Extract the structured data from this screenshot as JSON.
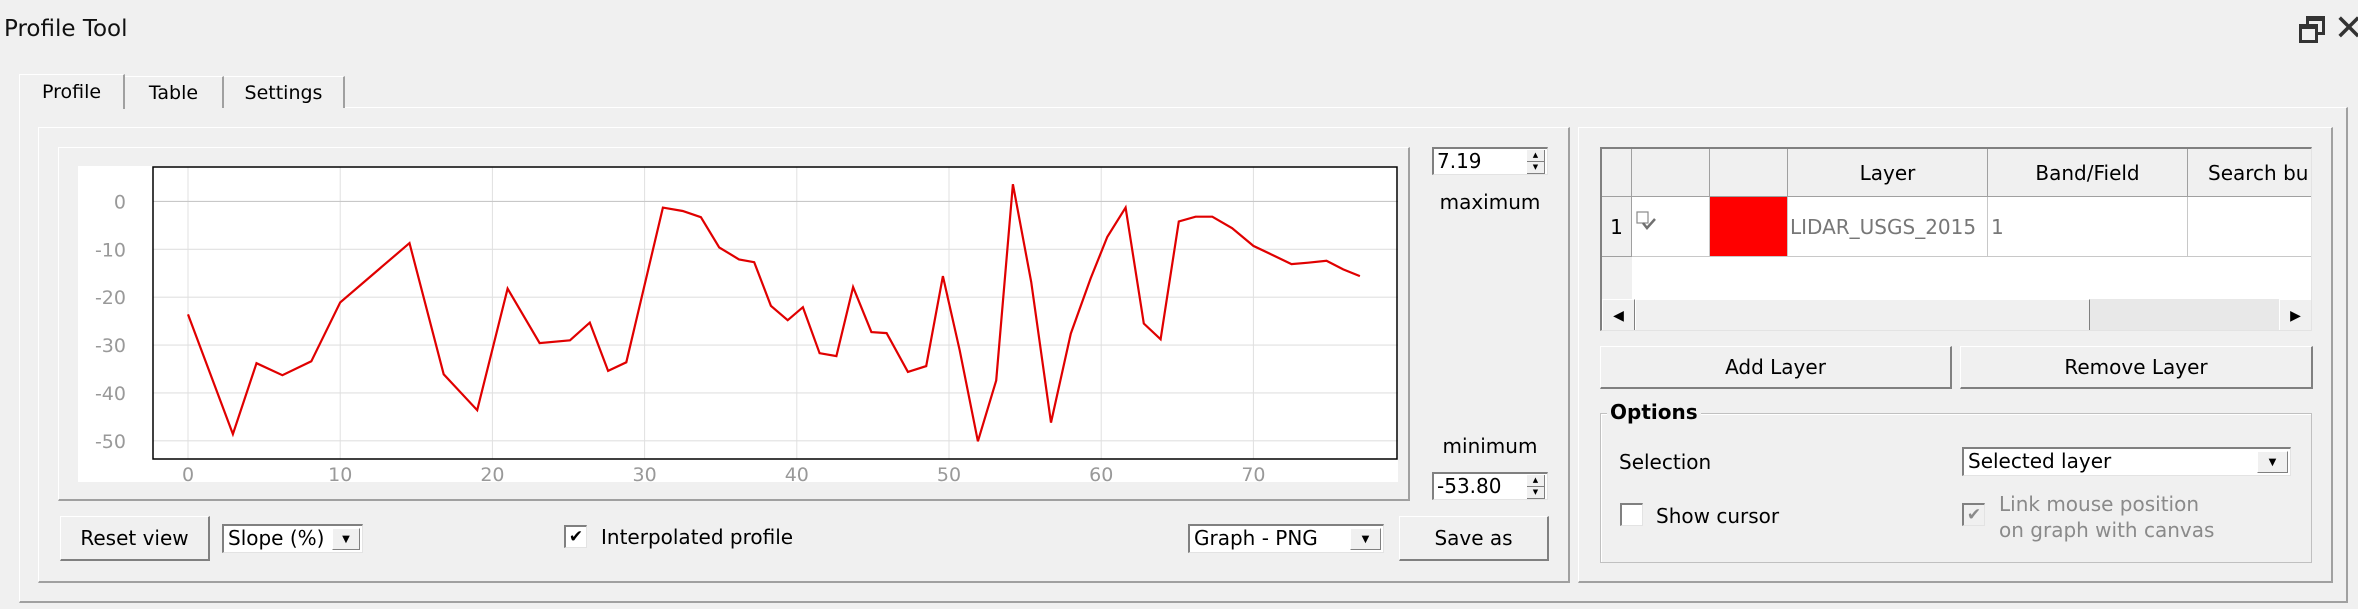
{
  "window": {
    "title": "Profile Tool",
    "restore_icon": "restore-window-icon",
    "close_icon": "close-icon"
  },
  "tabs": [
    {
      "label": "Profile",
      "selected": true
    },
    {
      "label": "Table",
      "selected": false
    },
    {
      "label": "Settings",
      "selected": false
    }
  ],
  "profile": {
    "max_value": "7.19",
    "max_label": "maximum",
    "min_value": "-53.80",
    "min_label": "minimum",
    "reset_view_label": "Reset view",
    "mode_select_value": "Slope (%)",
    "interpolated_label": "Interpolated profile",
    "interpolated_checked": true,
    "export_format_value": "Graph - PNG",
    "save_as_label": "Save as"
  },
  "layers_panel": {
    "columns": [
      "",
      "",
      "Layer",
      "Band/Field",
      "Search bu"
    ],
    "rows": [
      {
        "index": "1",
        "visible_icon": "checked-visibility-icon",
        "color": "#ff0000",
        "layer": "LIDAR_USGS_2015",
        "band": "1",
        "search": ""
      }
    ],
    "add_layer_label": "Add Layer",
    "remove_layer_label": "Remove Layer",
    "scroll_left_icon": "arrow-left-icon",
    "scroll_right_icon": "arrow-right-icon"
  },
  "options": {
    "title": "Options",
    "selection_label": "Selection",
    "selection_value": "Selected layer",
    "show_cursor_label": "Show cursor",
    "show_cursor_checked": false,
    "link_mouse_line1": "Link mouse position",
    "link_mouse_line2": "on graph with canvas",
    "link_mouse_checked": true,
    "link_mouse_enabled": false
  },
  "chart_data": {
    "type": "line",
    "title": "",
    "xlabel": "",
    "ylabel": "",
    "xlim": [
      -2.3,
      79.5
    ],
    "ylim": [
      -53.8,
      7.19
    ],
    "grid": true,
    "legend": "none",
    "x_ticks": [
      0,
      10,
      20,
      30,
      40,
      50,
      60,
      70
    ],
    "y_ticks": [
      0,
      -10,
      -20,
      -30,
      -40,
      -50
    ],
    "series": [
      {
        "name": "LIDAR_USGS_2015",
        "color": "#e00000",
        "x": [
          0,
          2.95,
          4.5,
          6.2,
          8.1,
          10.0,
          14.55,
          16.8,
          19.0,
          21.0,
          23.1,
          25.1,
          26.4,
          27.6,
          28.8,
          31.2,
          32.5,
          33.7,
          34.9,
          36.2,
          37.2,
          38.3,
          39.4,
          40.4,
          41.5,
          42.6,
          43.7,
          44.9,
          45.9,
          47.3,
          48.5,
          49.6,
          50.7,
          51.9,
          53.1,
          54.2,
          55.4,
          56.7,
          58.0,
          59.3,
          60.4,
          61.6,
          62.8,
          63.9,
          65.1,
          66.2,
          67.3,
          68.6,
          70.0,
          71.2,
          72.5,
          73.6,
          74.8,
          75.9,
          77.0
        ],
        "y": [
          -23.6,
          -48.6,
          -33.8,
          -36.3,
          -33.4,
          -21.1,
          -8.7,
          -36.1,
          -43.6,
          -18.2,
          -29.6,
          -29.0,
          -25.3,
          -35.4,
          -33.6,
          -1.3,
          -2.0,
          -3.3,
          -9.6,
          -12.1,
          -12.7,
          -21.8,
          -24.8,
          -22.1,
          -31.7,
          -32.3,
          -17.9,
          -27.3,
          -27.5,
          -35.6,
          -34.4,
          -15.6,
          -31.1,
          -50.1,
          -37.4,
          3.6,
          -16.8,
          -46.2,
          -27.6,
          -16.1,
          -7.4,
          -1.3,
          -25.5,
          -28.8,
          -4.2,
          -3.2,
          -3.2,
          -5.6,
          -9.3,
          -11.1,
          -13.1,
          -12.8,
          -12.4,
          -14.2,
          -15.6
        ]
      }
    ]
  }
}
